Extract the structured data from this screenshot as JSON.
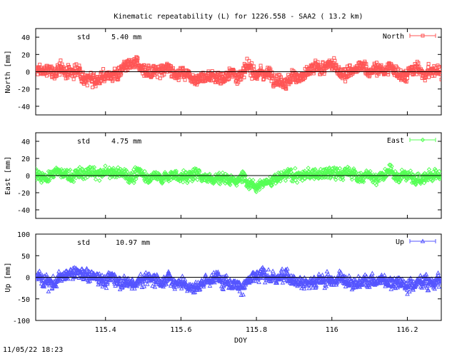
{
  "title": "Kinematic repeatability (L) for 1226.558 - SAA2  ( 13.2 km)",
  "timestamp": "11/05/22 18:23",
  "xlabel": "DOY",
  "chart_data": [
    {
      "type": "scatter",
      "ylabel": "North [mm]",
      "std_label": "std",
      "std_value": "5.40 mm",
      "series": [
        {
          "name": "North",
          "color": "#ff5555",
          "marker": "square",
          "noise_amp": 9,
          "mean": 0
        }
      ],
      "xlim": [
        115.215,
        116.29
      ],
      "ylim": [
        -50,
        50
      ],
      "yticks": [
        -40,
        -20,
        0,
        20,
        40
      ],
      "xticks": [
        115.4,
        115.6,
        115.8,
        116,
        116.2
      ],
      "zero_line": true
    },
    {
      "type": "scatter",
      "ylabel": "East [mm]",
      "std_label": "std",
      "std_value": "4.75 mm",
      "series": [
        {
          "name": "East",
          "color": "#55ff55",
          "marker": "diamond",
          "noise_amp": 8,
          "mean": 0
        }
      ],
      "xlim": [
        115.215,
        116.29
      ],
      "ylim": [
        -50,
        50
      ],
      "yticks": [
        -40,
        -20,
        0,
        20,
        40
      ],
      "xticks": [
        115.4,
        115.6,
        115.8,
        116,
        116.2
      ],
      "zero_line": true
    },
    {
      "type": "scatter",
      "ylabel": "Up [mm]",
      "std_label": "std",
      "std_value": "10.97 mm",
      "series": [
        {
          "name": "Up",
          "color": "#5555ff",
          "marker": "triangle",
          "noise_amp": 18,
          "mean": 0
        }
      ],
      "xlim": [
        115.215,
        116.29
      ],
      "ylim": [
        -100,
        100
      ],
      "yticks": [
        -100,
        -50,
        0,
        50,
        100
      ],
      "xticks": [
        115.4,
        115.6,
        115.8,
        116,
        116.2
      ],
      "xticklabels": [
        "115.4",
        "115.6",
        "115.8",
        "116",
        "116.2"
      ],
      "zero_line": true
    }
  ]
}
